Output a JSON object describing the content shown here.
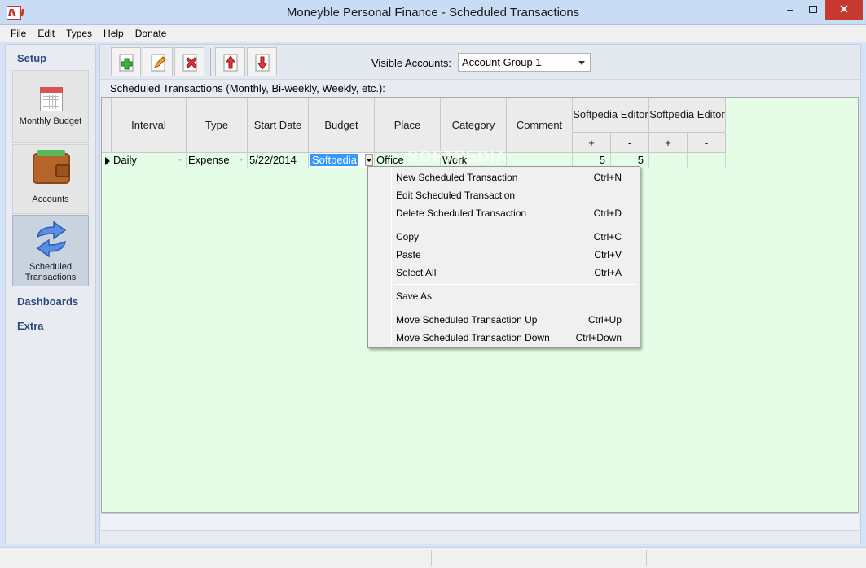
{
  "window": {
    "title": "Moneyble Personal Finance - Scheduled Transactions",
    "minimize_glyph": "‒",
    "close_glyph": "✕"
  },
  "menu": [
    "File",
    "Edit",
    "Types",
    "Help",
    "Donate"
  ],
  "sidebar": {
    "setup_heading": "Setup",
    "items": [
      {
        "label": "Monthly Budget",
        "icon": "calendar-icon"
      },
      {
        "label": "Accounts",
        "icon": "wallet-icon"
      },
      {
        "label": "Scheduled\nTransactions",
        "icon": "sync-arrows-icon",
        "active": true
      }
    ],
    "dashboards_heading": "Dashboards",
    "extra_heading": "Extra"
  },
  "toolbar": {
    "buttons": [
      "add-icon",
      "edit-icon",
      "delete-icon",
      "move-up-icon",
      "move-down-icon"
    ],
    "visible_accounts_label": "Visible Accounts:",
    "visible_accounts_value": "Account Group 1"
  },
  "section_label": "Scheduled Transactions (Monthly, Bi-weekly, Weekly, etc.):",
  "grid": {
    "columns": [
      "Interval",
      "Type",
      "Start Date",
      "Budget",
      "Place",
      "Category",
      "Comment"
    ],
    "group_headers": [
      "Softpedia Editor",
      "Softpedia Editor"
    ],
    "sub_headers": [
      "+",
      "-",
      "+",
      "-"
    ],
    "rows": [
      {
        "interval": "Daily",
        "type": "Expense",
        "start_date": "5/22/2014",
        "budget": "Softpedia",
        "place": "Office",
        "category": "Work",
        "comment": "",
        "g1_plus": "5",
        "g1_minus": "5",
        "g2_plus": "",
        "g2_minus": ""
      }
    ]
  },
  "watermark": "SOFTPEDIA",
  "context_menu": {
    "items": [
      {
        "label": "New Scheduled Transaction",
        "shortcut": "Ctrl+N"
      },
      {
        "label": "Edit Scheduled Transaction",
        "shortcut": ""
      },
      {
        "label": "Delete Scheduled Transaction",
        "shortcut": "Ctrl+D"
      },
      {
        "label": "Copy",
        "shortcut": "Ctrl+C"
      },
      {
        "label": "Paste",
        "shortcut": "Ctrl+V"
      },
      {
        "label": "Select All",
        "shortcut": "Ctrl+A"
      },
      {
        "label": "Save As",
        "shortcut": ""
      },
      {
        "label": "Move Scheduled Transaction Up",
        "shortcut": "Ctrl+Up"
      },
      {
        "label": "Move Scheduled Transaction Down",
        "shortcut": "Ctrl+Down"
      }
    ]
  },
  "colors": {
    "grid_background": "#e5fce6",
    "title_bar": "#c8dcf5",
    "close_button": "#c7392f",
    "selection": "#3399ff",
    "sidebar_heading": "#2b4b7e"
  }
}
